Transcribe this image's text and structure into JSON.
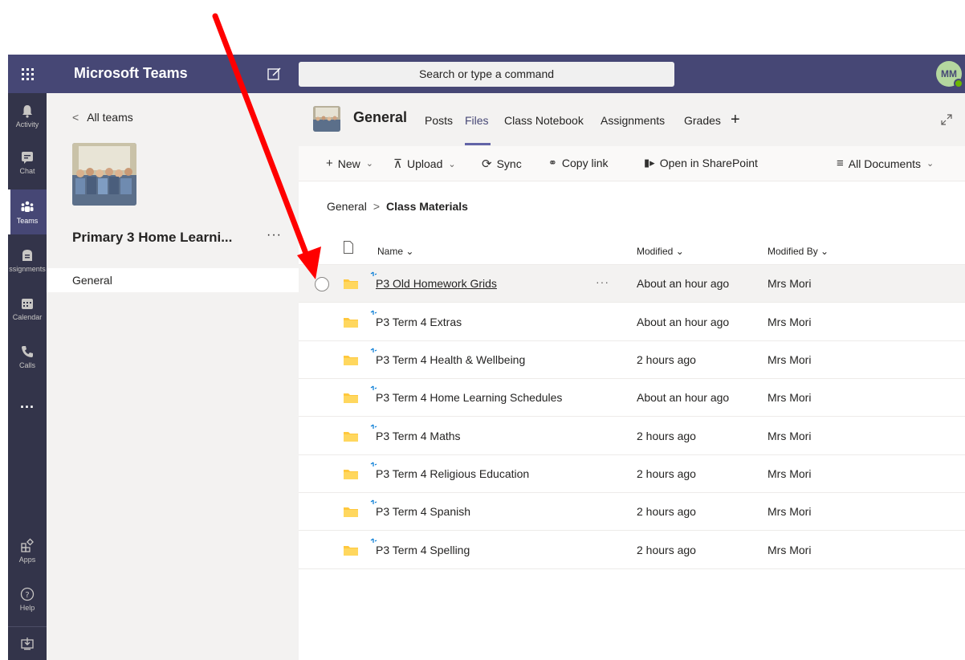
{
  "app": {
    "title": "Microsoft Teams"
  },
  "search": {
    "placeholder": "Search or type a command"
  },
  "user": {
    "initials": "MM",
    "status_color": "#6bb700"
  },
  "colors": {
    "topbar": "#464775",
    "rail": "#33344a",
    "accent": "#6264a7",
    "arrow": "#ff0000"
  },
  "rail": {
    "items": [
      {
        "label": "Activity",
        "icon": "bell-icon"
      },
      {
        "label": "Chat",
        "icon": "chat-icon"
      },
      {
        "label": "Teams",
        "icon": "teams-icon"
      },
      {
        "label": "ssignments",
        "icon": "assignments-icon"
      },
      {
        "label": "Calendar",
        "icon": "calendar-icon"
      },
      {
        "label": "Calls",
        "icon": "phone-icon"
      },
      {
        "label": "...",
        "icon": "more-icon"
      }
    ],
    "bottom": [
      {
        "label": "Apps",
        "icon": "apps-icon"
      },
      {
        "label": "Help",
        "icon": "help-icon"
      },
      {
        "label": "",
        "icon": "download-icon"
      }
    ]
  },
  "panel": {
    "back_label": "All teams",
    "team_name": "Primary 3 Home Learni...",
    "more": "···",
    "channel": "General"
  },
  "channel_header": {
    "name": "General",
    "tabs": [
      "Posts",
      "Files",
      "Class Notebook",
      "Assignments",
      "Grades",
      "+"
    ],
    "active_tab": "Files"
  },
  "toolbar": {
    "new_label": "New",
    "upload_label": "Upload",
    "sync_label": "Sync",
    "copy_link_label": "Copy link",
    "sharepoint_label": "Open in SharePoint",
    "view_label": "All Documents"
  },
  "breadcrumb": {
    "root": "General",
    "current": "Class Materials"
  },
  "list": {
    "columns": [
      "Name",
      "Modified",
      "Modified By"
    ],
    "row_more": "···",
    "rows": [
      {
        "name": "P3 Old Homework Grids",
        "modified": "About an hour ago",
        "modified_by": "Mrs Mori"
      },
      {
        "name": "P3 Term 4 Extras",
        "modified": "About an hour ago",
        "modified_by": "Mrs Mori"
      },
      {
        "name": "P3 Term 4 Health & Wellbeing",
        "modified": "2 hours ago",
        "modified_by": "Mrs Mori"
      },
      {
        "name": "P3 Term 4 Home Learning Schedules",
        "modified": "About an hour ago",
        "modified_by": "Mrs Mori"
      },
      {
        "name": "P3 Term 4 Maths",
        "modified": "2 hours ago",
        "modified_by": "Mrs Mori"
      },
      {
        "name": "P3 Term 4 Religious Education",
        "modified": "2 hours ago",
        "modified_by": "Mrs Mori"
      },
      {
        "name": "P3 Term 4 Spanish",
        "modified": "2 hours ago",
        "modified_by": "Mrs Mori"
      },
      {
        "name": "P3 Term 4 Spelling",
        "modified": "2 hours ago",
        "modified_by": "Mrs Mori"
      }
    ]
  }
}
